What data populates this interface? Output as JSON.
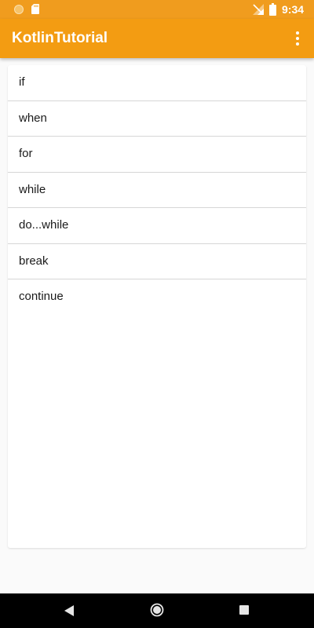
{
  "status_bar": {
    "time": "9:34",
    "icons": [
      "notification-dot-icon",
      "sd-card-icon",
      "signal-no-data-icon",
      "battery-icon"
    ]
  },
  "app_bar": {
    "title": "KotlinTutorial",
    "overflow_icon": "more-vert-icon"
  },
  "topics": {
    "items": [
      {
        "label": "if"
      },
      {
        "label": "when"
      },
      {
        "label": "for"
      },
      {
        "label": "while"
      },
      {
        "label": "do...while"
      },
      {
        "label": "break"
      },
      {
        "label": "continue"
      }
    ]
  },
  "nav_bar": {
    "icons": [
      "back-icon",
      "home-icon",
      "recents-icon"
    ]
  },
  "colors": {
    "status_bar": "#f09c1e",
    "app_bar": "#f39c12",
    "background": "#fafafa",
    "card": "#ffffff",
    "divider": "#d6d6d6",
    "nav_bar": "#000000"
  }
}
